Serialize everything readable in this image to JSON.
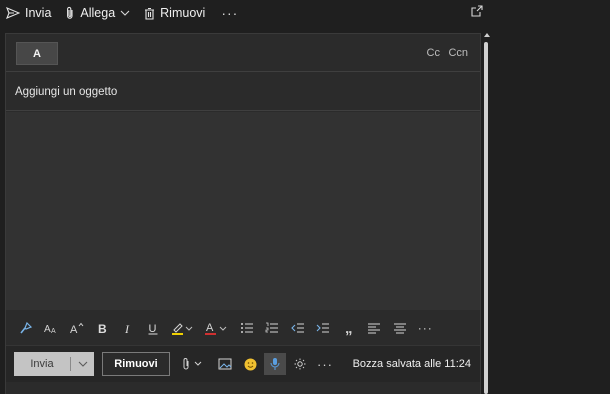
{
  "toolbar": {
    "send_label": "Invia",
    "attach_label": "Allega",
    "discard_label": "Rimuovi",
    "more_label": "···"
  },
  "recipients": {
    "to_label": "A",
    "cc_label": "Cc",
    "bcc_label": "Ccn"
  },
  "subject": {
    "placeholder": "Aggiungi un oggetto",
    "value": ""
  },
  "format_toolbar": {
    "more_label": "···",
    "quote_label": "„",
    "icons": [
      "format-painter-icon",
      "font-size-icon",
      "grow-font-icon",
      "bold-icon",
      "italic-icon",
      "underline-icon",
      "highlight-icon",
      "font-color-icon",
      "bullets-icon",
      "numbering-icon",
      "decrease-indent-icon",
      "increase-indent-icon",
      "quote-icon",
      "align-left-icon",
      "align-center-icon",
      "more-icon"
    ],
    "highlight_color": "#f0d000",
    "font_color": "#d03030"
  },
  "bottom_bar": {
    "send_label": "Invia",
    "discard_label": "Rimuovi",
    "more_label": "···",
    "status": "Bozza salvata alle 11:24"
  },
  "colors": {
    "background": "#1f1f1f",
    "panel": "#2b2b2b",
    "editor": "#323232",
    "send_button": "#c4c4c4",
    "active_icon_bg": "#4a4a4a"
  }
}
